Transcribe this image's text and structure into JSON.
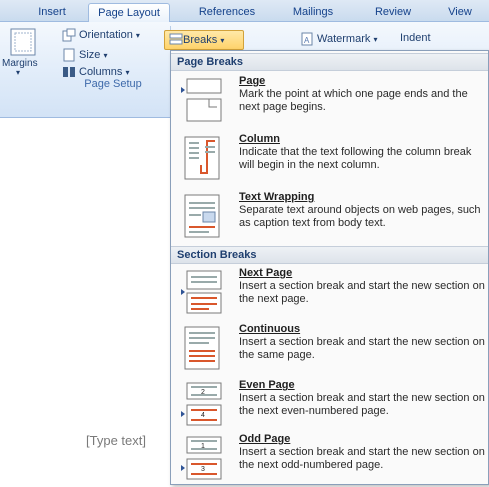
{
  "tabs": [
    {
      "label": "Insert",
      "active": false
    },
    {
      "label": "Page Layout",
      "active": true
    },
    {
      "label": "References",
      "active": false
    },
    {
      "label": "Mailings",
      "active": false
    },
    {
      "label": "Review",
      "active": false
    },
    {
      "label": "View",
      "active": false
    }
  ],
  "ribbon": {
    "margins_label": "Margins",
    "orientation_label": "Orientation",
    "size_label": "Size",
    "columns_label": "Columns",
    "breaks_label": "Breaks",
    "watermark_label": "Watermark",
    "indent_label": "Indent",
    "group_label": "Page Setup"
  },
  "document": {
    "placeholder": "[Type text]"
  },
  "menu": {
    "page_breaks_header": "Page Breaks",
    "section_breaks_header": "Section Breaks",
    "items": [
      {
        "title": "Page",
        "desc": "Mark the point at which one page ends and the next page begins."
      },
      {
        "title": "Column",
        "desc": "Indicate that the text following the column break will begin in the next column."
      },
      {
        "title": "Text Wrapping",
        "desc": "Separate text around objects on web pages, such as caption text from body text."
      },
      {
        "title": "Next Page",
        "desc": "Insert a section break and start the new section on the next page."
      },
      {
        "title": "Continuous",
        "desc": "Insert a section break and start the new section on the same page."
      },
      {
        "title": "Even Page",
        "desc": "Insert a section break and start the new section on the next even-numbered page."
      },
      {
        "title": "Odd Page",
        "desc": "Insert a section break and start the new section on the next odd-numbered page."
      }
    ],
    "even_page_number": "2",
    "even_page_number_next": "4",
    "odd_page_number": "1",
    "odd_page_number_next": "3"
  },
  "colors": {
    "tab_text": "#15428b",
    "ribbon_bg": "#dfebf9",
    "breaks_highlight": "#ffd36b",
    "section_marker": "#d9572c"
  }
}
